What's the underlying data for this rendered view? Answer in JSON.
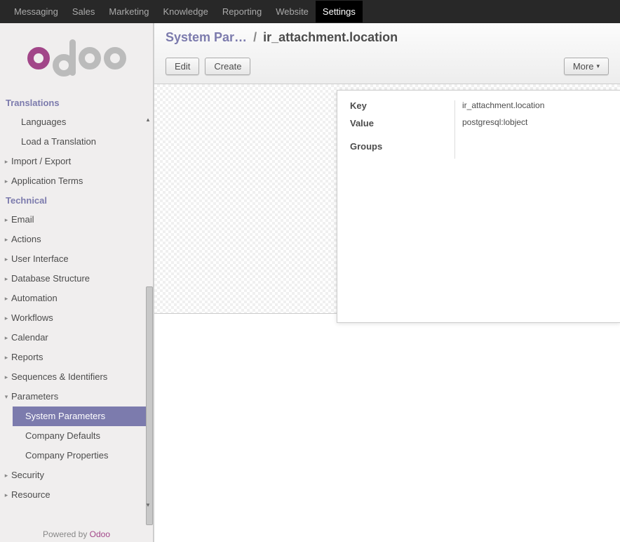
{
  "topnav": {
    "items": [
      {
        "label": "Messaging"
      },
      {
        "label": "Sales"
      },
      {
        "label": "Marketing"
      },
      {
        "label": "Knowledge"
      },
      {
        "label": "Reporting"
      },
      {
        "label": "Website"
      },
      {
        "label": "Settings",
        "active": true
      }
    ]
  },
  "sidebar": {
    "section1_title": "Translations",
    "translations": {
      "languages": "Languages",
      "load_translation": "Load a Translation",
      "import_export": "Import / Export",
      "application_terms": "Application Terms"
    },
    "section2_title": "Technical",
    "technical": {
      "email": "Email",
      "actions": "Actions",
      "ui": "User Interface",
      "db": "Database Structure",
      "automation": "Automation",
      "workflows": "Workflows",
      "calendar": "Calendar",
      "reports": "Reports",
      "sequences": "Sequences & Identifiers",
      "parameters": "Parameters",
      "sys_params": "System Parameters",
      "company_defaults": "Company Defaults",
      "company_properties": "Company Properties",
      "security": "Security",
      "resource": "Resource"
    },
    "powered_prefix": "Powered by ",
    "powered_link": "Odoo"
  },
  "breadcrumb": {
    "parent": "System Par…",
    "sep": "/",
    "current": "ir_attachment.location"
  },
  "toolbar": {
    "edit": "Edit",
    "create": "Create",
    "more": "More"
  },
  "form": {
    "key_label": "Key",
    "key_value": "ir_attachment.location",
    "value_label": "Value",
    "value_value": "postgresql:lobject",
    "groups_label": "Groups"
  }
}
